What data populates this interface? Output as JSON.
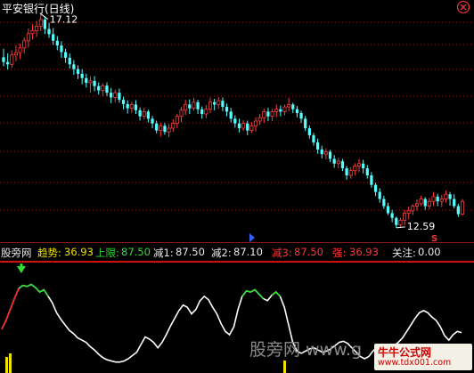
{
  "title": "平安银行(日线)",
  "price_labels": {
    "high": "17.12",
    "low": "12.59"
  },
  "markers": {
    "s_label": "S"
  },
  "indicator": {
    "name": "股旁网",
    "trend_label": "趋势:",
    "trend_value": "36.93",
    "upper_label": "上限:",
    "upper_value": "87.50",
    "reduce1_label": "减1:",
    "reduce1_value": "87.50",
    "reduce2_label": "减2:",
    "reduce2_value": "87.10",
    "reduce3_label": "减3:",
    "reduce3_value": "87.50",
    "strong_label": "强:",
    "strong_value": "36.93",
    "focus_label": "关注:",
    "focus_value": "0.00"
  },
  "watermark": {
    "text": "股旁网 www.g",
    "logo_line1": "牛牛公式网",
    "logo_line2": "www.tdx001.com"
  },
  "colors": {
    "up_candle": "#ff3c3c",
    "down_candle": "#54ffff",
    "trend_line": "#ffffff",
    "strong_segment": "#33dd33",
    "rising_segment": "#ff2020",
    "grid": "#a01818",
    "focus_bar": "#f0e000"
  },
  "chart_data": [
    {
      "type": "candlestick",
      "title": "平安银行(日线)",
      "ylim": [
        12.4,
        17.3
      ],
      "annotations": [
        "17.12",
        "12.59"
      ],
      "candles": [
        [
          16.2,
          16.38,
          16.01,
          16.1
        ],
        [
          16.1,
          16.28,
          15.94,
          16.05
        ],
        [
          16.05,
          16.35,
          15.98,
          16.25
        ],
        [
          16.25,
          16.45,
          16.12,
          16.3
        ],
        [
          16.3,
          16.49,
          16.16,
          16.4
        ],
        [
          16.4,
          16.62,
          16.28,
          16.55
        ],
        [
          16.55,
          16.81,
          16.41,
          16.7
        ],
        [
          16.7,
          16.9,
          16.58,
          16.76
        ],
        [
          16.76,
          16.97,
          16.63,
          16.86
        ],
        [
          16.86,
          17.12,
          16.75,
          17.0
        ],
        [
          17.0,
          17.07,
          16.69,
          16.8
        ],
        [
          16.8,
          16.93,
          16.61,
          16.69
        ],
        [
          16.69,
          16.82,
          16.46,
          16.55
        ],
        [
          16.55,
          16.65,
          16.35,
          16.45
        ],
        [
          16.45,
          16.54,
          16.19,
          16.31
        ],
        [
          16.31,
          16.38,
          16.08,
          16.19
        ],
        [
          16.19,
          16.28,
          15.96,
          16.05
        ],
        [
          16.05,
          16.14,
          15.83,
          15.95
        ],
        [
          15.95,
          16.03,
          15.74,
          15.85
        ],
        [
          15.85,
          15.95,
          15.63,
          15.76
        ],
        [
          15.76,
          15.85,
          15.56,
          15.66
        ],
        [
          15.66,
          15.8,
          15.45,
          15.7
        ],
        [
          15.7,
          15.8,
          15.48,
          15.59
        ],
        [
          15.59,
          15.67,
          15.41,
          15.5
        ],
        [
          15.5,
          15.65,
          15.38,
          15.6
        ],
        [
          15.6,
          15.67,
          15.38,
          15.45
        ],
        [
          15.45,
          15.55,
          15.23,
          15.35
        ],
        [
          15.35,
          15.52,
          15.24,
          15.45
        ],
        [
          15.45,
          15.54,
          15.24,
          15.3
        ],
        [
          15.3,
          15.37,
          15.1,
          15.21
        ],
        [
          15.21,
          15.29,
          15.01,
          15.12
        ],
        [
          15.12,
          15.26,
          15.02,
          15.2
        ],
        [
          15.2,
          15.29,
          15.0,
          15.08
        ],
        [
          15.08,
          15.14,
          14.86,
          14.95
        ],
        [
          14.95,
          15.13,
          14.88,
          15.05
        ],
        [
          15.05,
          15.09,
          14.82,
          14.9
        ],
        [
          14.9,
          14.96,
          14.7,
          14.8
        ],
        [
          14.8,
          14.86,
          14.59,
          14.65
        ],
        [
          14.65,
          14.81,
          14.52,
          14.75
        ],
        [
          14.75,
          14.81,
          14.56,
          14.62
        ],
        [
          14.62,
          14.79,
          14.51,
          14.7
        ],
        [
          14.7,
          14.89,
          14.62,
          14.8
        ],
        [
          14.8,
          15.0,
          14.7,
          14.95
        ],
        [
          14.95,
          15.15,
          14.83,
          15.08
        ],
        [
          15.08,
          15.3,
          14.98,
          15.2
        ],
        [
          15.2,
          15.31,
          15.0,
          15.12
        ],
        [
          15.12,
          15.34,
          15.07,
          15.25
        ],
        [
          15.25,
          15.3,
          15.0,
          15.1
        ],
        [
          15.1,
          15.16,
          14.9,
          15.0
        ],
        [
          15.0,
          15.19,
          14.91,
          15.1
        ],
        [
          15.1,
          15.35,
          15.02,
          15.25
        ],
        [
          15.25,
          15.32,
          15.08,
          15.2
        ],
        [
          15.2,
          15.36,
          15.11,
          15.28
        ],
        [
          15.28,
          15.35,
          15.06,
          15.15
        ],
        [
          15.15,
          15.22,
          14.95,
          15.05
        ],
        [
          15.05,
          15.13,
          14.82,
          14.9
        ],
        [
          14.9,
          14.97,
          14.71,
          14.8
        ],
        [
          14.8,
          14.9,
          14.61,
          14.7
        ],
        [
          14.7,
          14.87,
          14.64,
          14.8
        ],
        [
          14.8,
          14.86,
          14.55,
          14.65
        ],
        [
          14.65,
          14.83,
          14.6,
          14.75
        ],
        [
          14.75,
          14.93,
          14.63,
          14.85
        ],
        [
          14.85,
          15.0,
          14.77,
          14.92
        ],
        [
          14.92,
          15.11,
          14.81,
          15.05
        ],
        [
          15.05,
          15.13,
          14.85,
          14.95
        ],
        [
          14.95,
          15.11,
          14.85,
          15.05
        ],
        [
          15.05,
          15.2,
          14.93,
          15.1
        ],
        [
          15.1,
          15.18,
          14.95,
          15.05
        ],
        [
          15.05,
          15.2,
          14.97,
          15.15
        ],
        [
          15.15,
          15.34,
          15.06,
          15.2
        ],
        [
          15.2,
          15.24,
          15.02,
          15.1
        ],
        [
          15.1,
          15.17,
          14.93,
          15.02
        ],
        [
          15.02,
          15.07,
          14.81,
          14.9
        ],
        [
          14.9,
          14.96,
          14.64,
          14.7
        ],
        [
          14.7,
          14.76,
          14.48,
          14.55
        ],
        [
          14.55,
          14.6,
          14.33,
          14.4
        ],
        [
          14.4,
          14.48,
          14.16,
          14.25
        ],
        [
          14.25,
          14.33,
          14.06,
          14.15
        ],
        [
          14.15,
          14.27,
          14.04,
          14.2
        ],
        [
          14.2,
          14.24,
          13.98,
          14.05
        ],
        [
          14.05,
          14.13,
          13.86,
          13.95
        ],
        [
          13.95,
          14.07,
          13.85,
          14.0
        ],
        [
          14.0,
          14.05,
          13.79,
          13.85
        ],
        [
          13.85,
          13.9,
          13.61,
          13.7
        ],
        [
          13.7,
          13.87,
          13.63,
          13.8
        ],
        [
          13.8,
          13.96,
          13.7,
          13.9
        ],
        [
          13.9,
          14.05,
          13.77,
          13.95
        ],
        [
          13.95,
          14.03,
          13.74,
          13.85
        ],
        [
          13.85,
          13.92,
          13.63,
          13.7
        ],
        [
          13.7,
          13.77,
          13.44,
          13.5
        ],
        [
          13.5,
          13.55,
          13.26,
          13.35
        ],
        [
          13.35,
          13.43,
          13.12,
          13.2
        ],
        [
          13.2,
          13.27,
          12.99,
          13.05
        ],
        [
          13.05,
          13.12,
          12.86,
          12.9
        ],
        [
          12.9,
          12.97,
          12.71,
          12.8
        ],
        [
          12.8,
          12.83,
          12.59,
          12.65
        ],
        [
          12.65,
          12.8,
          12.59,
          12.75
        ],
        [
          12.75,
          12.97,
          12.64,
          12.9
        ],
        [
          12.9,
          13.04,
          12.77,
          12.95
        ],
        [
          12.95,
          13.09,
          12.86,
          13.05
        ],
        [
          13.05,
          13.19,
          12.95,
          13.1
        ],
        [
          13.1,
          13.27,
          13.05,
          13.2
        ],
        [
          13.2,
          13.24,
          12.97,
          13.05
        ],
        [
          13.05,
          13.22,
          12.98,
          13.15
        ],
        [
          13.15,
          13.35,
          13.05,
          13.25
        ],
        [
          13.25,
          13.31,
          13.05,
          13.15
        ],
        [
          13.15,
          13.29,
          13.03,
          13.2
        ],
        [
          13.2,
          13.38,
          13.12,
          13.3
        ],
        [
          13.3,
          13.35,
          13.06,
          13.2
        ],
        [
          13.2,
          13.3,
          13.0,
          13.05
        ],
        [
          13.05,
          13.1,
          12.82,
          12.88
        ],
        [
          12.88,
          13.2,
          12.85,
          13.15
        ]
      ]
    },
    {
      "type": "line",
      "title": "股旁网",
      "ylim": [
        0,
        100
      ],
      "series": [
        {
          "name": "趋势",
          "values": [
            40,
            48,
            58,
            68,
            77,
            80,
            79,
            81,
            78,
            74,
            76,
            70,
            64,
            55,
            49,
            44,
            39,
            36,
            32,
            30,
            28,
            24,
            21,
            17,
            14,
            12,
            11,
            10,
            10,
            11,
            13,
            16,
            19,
            26,
            33,
            31,
            28,
            23,
            28,
            35,
            43,
            50,
            57,
            62,
            60,
            54,
            58,
            66,
            70,
            67,
            60,
            54,
            45,
            38,
            35,
            42,
            58,
            70,
            75,
            74,
            76,
            72,
            68,
            66,
            71,
            74,
            70,
            60,
            44,
            28,
            20,
            18,
            20,
            22,
            23,
            21,
            19,
            20,
            22,
            25,
            28,
            29,
            27,
            23,
            19,
            15,
            13,
            15,
            20,
            24,
            23,
            21,
            22,
            25,
            28,
            32,
            38,
            44,
            50,
            55,
            57,
            55,
            51,
            48,
            42,
            34,
            30,
            35,
            38,
            36.93
          ]
        }
      ]
    }
  ]
}
